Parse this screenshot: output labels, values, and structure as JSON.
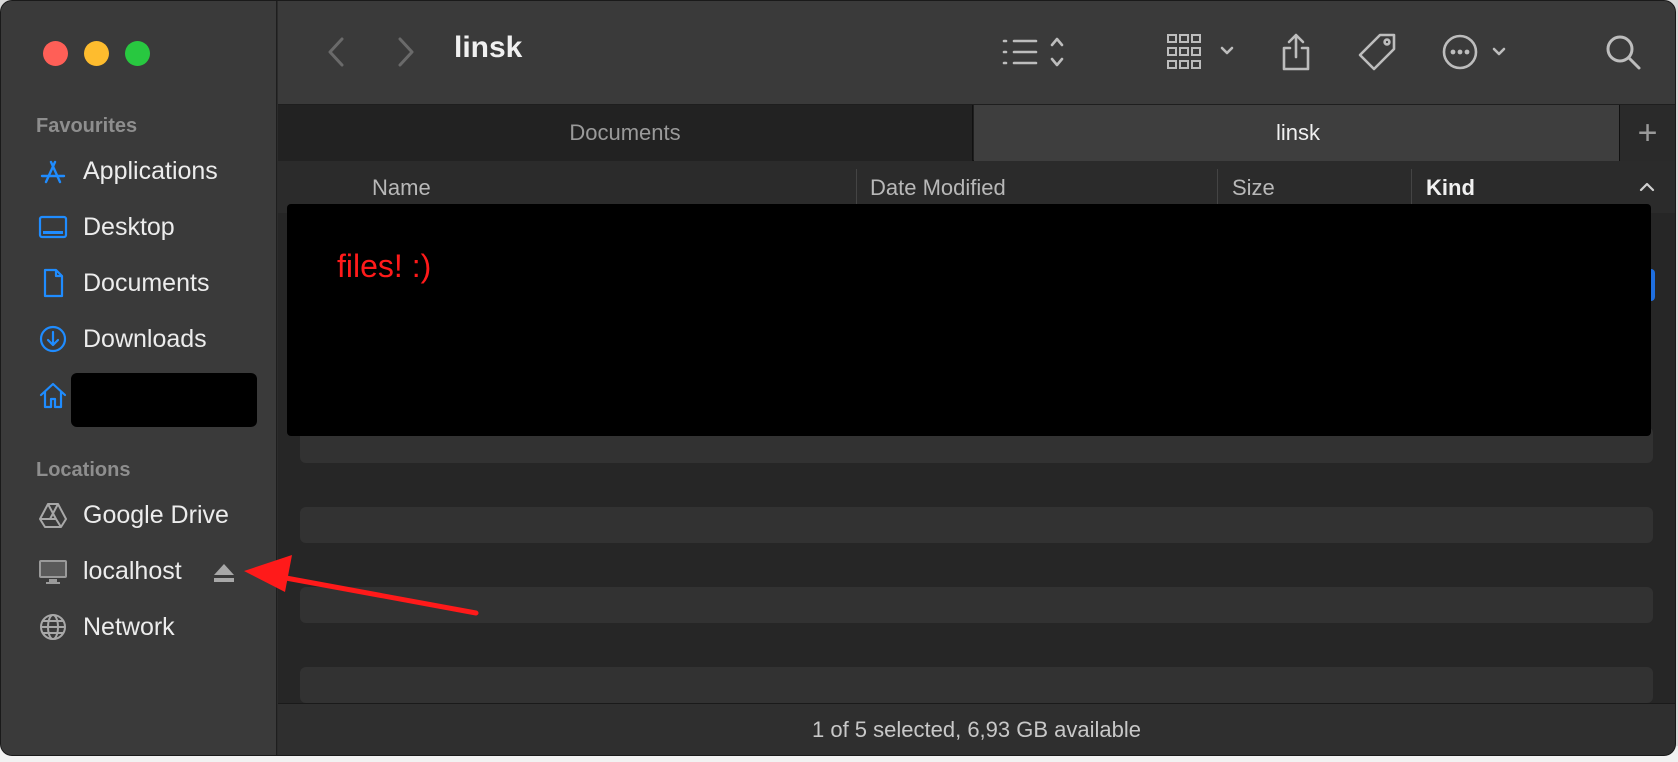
{
  "window": {
    "title": "linsk"
  },
  "sidebar": {
    "favourites_heading": "Favourites",
    "favourites": [
      {
        "label": "Applications",
        "icon": "applications-icon"
      },
      {
        "label": "Desktop",
        "icon": "desktop-icon"
      },
      {
        "label": "Documents",
        "icon": "document-icon"
      },
      {
        "label": "Downloads",
        "icon": "downloads-icon"
      },
      {
        "label": "",
        "icon": "home-icon"
      }
    ],
    "locations_heading": "Locations",
    "locations": [
      {
        "label": "Google Drive",
        "icon": "google-drive-icon"
      },
      {
        "label": "localhost",
        "icon": "computer-icon"
      },
      {
        "label": "Network",
        "icon": "network-icon"
      }
    ]
  },
  "tabs": [
    {
      "label": "Documents",
      "active": false
    },
    {
      "label": "linsk",
      "active": true
    }
  ],
  "columns": {
    "name": "Name",
    "date_modified": "Date Modified",
    "size": "Size",
    "kind": "Kind"
  },
  "overlay": {
    "text": "files! :)"
  },
  "status": {
    "text": "1 of 5 selected, 6,93 GB available"
  },
  "colors": {
    "accent": "#1f8cff",
    "annotation_red": "#ff1a1a"
  }
}
